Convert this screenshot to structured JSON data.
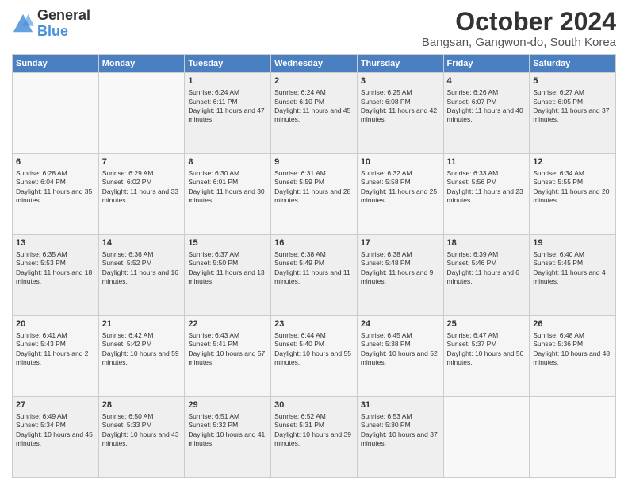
{
  "header": {
    "logo_line1": "General",
    "logo_line2": "Blue",
    "title": "October 2024",
    "subtitle": "Bangsan, Gangwon-do, South Korea"
  },
  "days_of_week": [
    "Sunday",
    "Monday",
    "Tuesday",
    "Wednesday",
    "Thursday",
    "Friday",
    "Saturday"
  ],
  "weeks": [
    [
      {
        "day": null
      },
      {
        "day": null
      },
      {
        "day": "1",
        "sunrise": "Sunrise: 6:24 AM",
        "sunset": "Sunset: 6:11 PM",
        "daylight": "Daylight: 11 hours and 47 minutes."
      },
      {
        "day": "2",
        "sunrise": "Sunrise: 6:24 AM",
        "sunset": "Sunset: 6:10 PM",
        "daylight": "Daylight: 11 hours and 45 minutes."
      },
      {
        "day": "3",
        "sunrise": "Sunrise: 6:25 AM",
        "sunset": "Sunset: 6:08 PM",
        "daylight": "Daylight: 11 hours and 42 minutes."
      },
      {
        "day": "4",
        "sunrise": "Sunrise: 6:26 AM",
        "sunset": "Sunset: 6:07 PM",
        "daylight": "Daylight: 11 hours and 40 minutes."
      },
      {
        "day": "5",
        "sunrise": "Sunrise: 6:27 AM",
        "sunset": "Sunset: 6:05 PM",
        "daylight": "Daylight: 11 hours and 37 minutes."
      }
    ],
    [
      {
        "day": "6",
        "sunrise": "Sunrise: 6:28 AM",
        "sunset": "Sunset: 6:04 PM",
        "daylight": "Daylight: 11 hours and 35 minutes."
      },
      {
        "day": "7",
        "sunrise": "Sunrise: 6:29 AM",
        "sunset": "Sunset: 6:02 PM",
        "daylight": "Daylight: 11 hours and 33 minutes."
      },
      {
        "day": "8",
        "sunrise": "Sunrise: 6:30 AM",
        "sunset": "Sunset: 6:01 PM",
        "daylight": "Daylight: 11 hours and 30 minutes."
      },
      {
        "day": "9",
        "sunrise": "Sunrise: 6:31 AM",
        "sunset": "Sunset: 5:59 PM",
        "daylight": "Daylight: 11 hours and 28 minutes."
      },
      {
        "day": "10",
        "sunrise": "Sunrise: 6:32 AM",
        "sunset": "Sunset: 5:58 PM",
        "daylight": "Daylight: 11 hours and 25 minutes."
      },
      {
        "day": "11",
        "sunrise": "Sunrise: 6:33 AM",
        "sunset": "Sunset: 5:56 PM",
        "daylight": "Daylight: 11 hours and 23 minutes."
      },
      {
        "day": "12",
        "sunrise": "Sunrise: 6:34 AM",
        "sunset": "Sunset: 5:55 PM",
        "daylight": "Daylight: 11 hours and 20 minutes."
      }
    ],
    [
      {
        "day": "13",
        "sunrise": "Sunrise: 6:35 AM",
        "sunset": "Sunset: 5:53 PM",
        "daylight": "Daylight: 11 hours and 18 minutes."
      },
      {
        "day": "14",
        "sunrise": "Sunrise: 6:36 AM",
        "sunset": "Sunset: 5:52 PM",
        "daylight": "Daylight: 11 hours and 16 minutes."
      },
      {
        "day": "15",
        "sunrise": "Sunrise: 6:37 AM",
        "sunset": "Sunset: 5:50 PM",
        "daylight": "Daylight: 11 hours and 13 minutes."
      },
      {
        "day": "16",
        "sunrise": "Sunrise: 6:38 AM",
        "sunset": "Sunset: 5:49 PM",
        "daylight": "Daylight: 11 hours and 11 minutes."
      },
      {
        "day": "17",
        "sunrise": "Sunrise: 6:38 AM",
        "sunset": "Sunset: 5:48 PM",
        "daylight": "Daylight: 11 hours and 9 minutes."
      },
      {
        "day": "18",
        "sunrise": "Sunrise: 6:39 AM",
        "sunset": "Sunset: 5:46 PM",
        "daylight": "Daylight: 11 hours and 6 minutes."
      },
      {
        "day": "19",
        "sunrise": "Sunrise: 6:40 AM",
        "sunset": "Sunset: 5:45 PM",
        "daylight": "Daylight: 11 hours and 4 minutes."
      }
    ],
    [
      {
        "day": "20",
        "sunrise": "Sunrise: 6:41 AM",
        "sunset": "Sunset: 5:43 PM",
        "daylight": "Daylight: 11 hours and 2 minutes."
      },
      {
        "day": "21",
        "sunrise": "Sunrise: 6:42 AM",
        "sunset": "Sunset: 5:42 PM",
        "daylight": "Daylight: 10 hours and 59 minutes."
      },
      {
        "day": "22",
        "sunrise": "Sunrise: 6:43 AM",
        "sunset": "Sunset: 5:41 PM",
        "daylight": "Daylight: 10 hours and 57 minutes."
      },
      {
        "day": "23",
        "sunrise": "Sunrise: 6:44 AM",
        "sunset": "Sunset: 5:40 PM",
        "daylight": "Daylight: 10 hours and 55 minutes."
      },
      {
        "day": "24",
        "sunrise": "Sunrise: 6:45 AM",
        "sunset": "Sunset: 5:38 PM",
        "daylight": "Daylight: 10 hours and 52 minutes."
      },
      {
        "day": "25",
        "sunrise": "Sunrise: 6:47 AM",
        "sunset": "Sunset: 5:37 PM",
        "daylight": "Daylight: 10 hours and 50 minutes."
      },
      {
        "day": "26",
        "sunrise": "Sunrise: 6:48 AM",
        "sunset": "Sunset: 5:36 PM",
        "daylight": "Daylight: 10 hours and 48 minutes."
      }
    ],
    [
      {
        "day": "27",
        "sunrise": "Sunrise: 6:49 AM",
        "sunset": "Sunset: 5:34 PM",
        "daylight": "Daylight: 10 hours and 45 minutes."
      },
      {
        "day": "28",
        "sunrise": "Sunrise: 6:50 AM",
        "sunset": "Sunset: 5:33 PM",
        "daylight": "Daylight: 10 hours and 43 minutes."
      },
      {
        "day": "29",
        "sunrise": "Sunrise: 6:51 AM",
        "sunset": "Sunset: 5:32 PM",
        "daylight": "Daylight: 10 hours and 41 minutes."
      },
      {
        "day": "30",
        "sunrise": "Sunrise: 6:52 AM",
        "sunset": "Sunset: 5:31 PM",
        "daylight": "Daylight: 10 hours and 39 minutes."
      },
      {
        "day": "31",
        "sunrise": "Sunrise: 6:53 AM",
        "sunset": "Sunset: 5:30 PM",
        "daylight": "Daylight: 10 hours and 37 minutes."
      },
      {
        "day": null
      },
      {
        "day": null
      }
    ]
  ]
}
